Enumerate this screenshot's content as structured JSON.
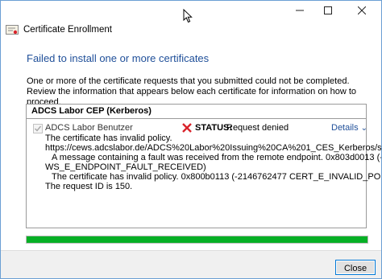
{
  "window": {
    "app_title": "Certificate Enrollment",
    "controls": {
      "minimize_icon": "minimize-icon",
      "maximize_icon": "maximize-icon",
      "close_icon": "close-icon"
    }
  },
  "main": {
    "heading": "Failed to install one or more certificates",
    "description": "One or more of the certificate requests that you submitted could not be completed. Review the information that appears below each certificate for information on how to proceed."
  },
  "panel": {
    "header": "ADCS Labor CEP (Kerberos)",
    "certificate": {
      "name": "ADCS Labor Benutzer",
      "status_label": "STATUS:",
      "status_value": "Request denied",
      "details_label": "Details",
      "messages": [
        "The certificate has invalid policy.",
        "https://cews.adcslabor.de/ADCS%20Labor%20Issuing%20CA%201_CES_Kerberos/service.svc/CES",
        "A message containing a fault was received from the remote endpoint. 0x803d0013 (-2143485933",
        "WS_E_ENDPOINT_FAULT_RECEIVED)",
        "The certificate has invalid policy. 0x800b0113 (-2146762477 CERT_E_INVALID_POLICY)",
        "The request ID is 150."
      ]
    }
  },
  "progress": {
    "value": 1.0,
    "color": "#06b025"
  },
  "footer": {
    "close_label": "Close"
  },
  "colors": {
    "accent": "#1f4f99",
    "error": "#d9232b",
    "button_border": "#0078d7"
  }
}
